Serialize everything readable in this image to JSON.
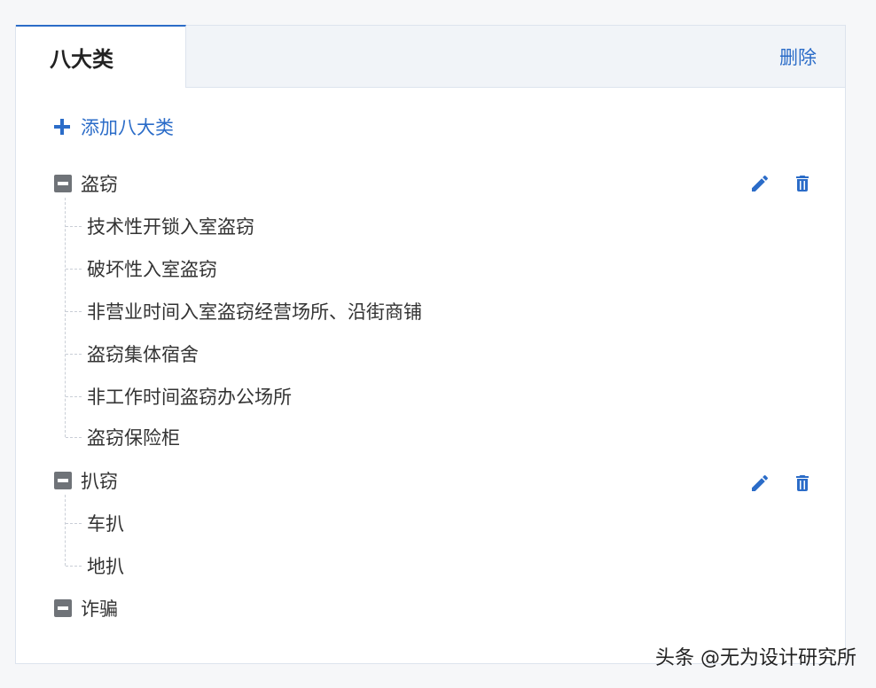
{
  "tabs": {
    "active_label": "八大类",
    "delete_label": "删除"
  },
  "add_label": "添加八大类",
  "categories": [
    {
      "label": "盗窃",
      "children": [
        "技术性开锁入室盗窃",
        "破坏性入室盗窃",
        "非营业时间入室盗窃经营场所、沿街商铺",
        "盗窃集体宿舍",
        "非工作时间盗窃办公场所",
        "盗窃保险柜"
      ]
    },
    {
      "label": "扒窃",
      "children": [
        "车扒",
        "地扒"
      ]
    },
    {
      "label": "诈骗",
      "children": []
    }
  ],
  "icons": {
    "add": "plus-icon",
    "collapse": "minus-square-icon",
    "edit": "pencil-icon",
    "delete": "trash-icon"
  },
  "colors": {
    "accent": "#2b6cc8",
    "collapse_box": "#6f7378"
  },
  "watermark": "头条 @无为设计研究所"
}
